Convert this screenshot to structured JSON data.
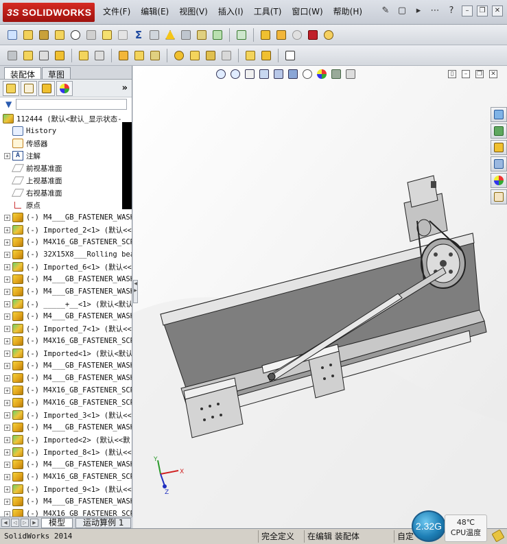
{
  "app": {
    "logo": "SOLIDWORKS",
    "menus": [
      "文件(F)",
      "编辑(E)",
      "视图(V)",
      "插入(I)",
      "工具(T)",
      "窗口(W)",
      "帮助(H)"
    ],
    "help_glyph": "?"
  },
  "feature_manager": {
    "tabs": [
      "装配体",
      "草图"
    ],
    "more_glyph": "»",
    "root": "112444  (默认<默认_显示状态-",
    "special_items": [
      {
        "label": "History",
        "icon": "history-icon"
      },
      {
        "label": "传感器",
        "icon": "sensor-icon"
      },
      {
        "label": "注解",
        "icon": "annotation-icon"
      },
      {
        "label": "前视基准面",
        "icon": "plane-icon"
      },
      {
        "label": "上视基准面",
        "icon": "plane-icon"
      },
      {
        "label": "右视基准面",
        "icon": "plane-icon"
      },
      {
        "label": "原点",
        "icon": "origin-icon"
      }
    ],
    "components": [
      "(-) M4___GB_FASTENER_WASH",
      "(-) Imported_2<1> (默认<<",
      "(-) M4X16_GB_FASTENER_SCR",
      "(-) 32X15X8___Rolling bea",
      "(-) Imported_6<1> (默认<<",
      "(-) M4___GB_FASTENER_WASH",
      "(-) M4___GB_FASTENER_WASH",
      "(-) _____+__<1> (默认<默认",
      "(-) M4___GB_FASTENER_WASH",
      "(-) Imported_7<1> (默认<<",
      "(-) M4X16_GB_FASTENER_SCR",
      "(-) Imported<1> (默认<默认",
      "(-) M4___GB_FASTENER_WASH",
      "(-) M4___GB_FASTENER_WASH",
      "(-) M4X16_GB_FASTENER_SCR",
      "(-) M4X16_GB_FASTENER_SCR",
      "(-) Imported_3<1> (默认<<",
      "(-) M4___GB_FASTENER_WASH",
      "(-) Imported<2> (默认<<默",
      "(-) Imported_8<1> (默认<<",
      "(-) M4___GB_FASTENER_WASH",
      "(-) M4X16_GB_FASTENER_SCR",
      "(-) Imported_9<1> (默认<<",
      "(-) M4___GB_FASTENER_WASH",
      "(-) M4X16_GB_FASTENER_SCR"
    ]
  },
  "bottom_tabs": [
    "模型",
    "运动算例 1"
  ],
  "status": {
    "app_version": "SolidWorks 2014",
    "definition": "完全定义",
    "editing": "在编辑 装配体",
    "custom": "自定",
    "cpu_freq": "2.32G",
    "cpu_temp": "48℃",
    "cpu_label": "CPU温度"
  },
  "triad": {
    "x": "X",
    "y": "Y",
    "z": "Z"
  }
}
